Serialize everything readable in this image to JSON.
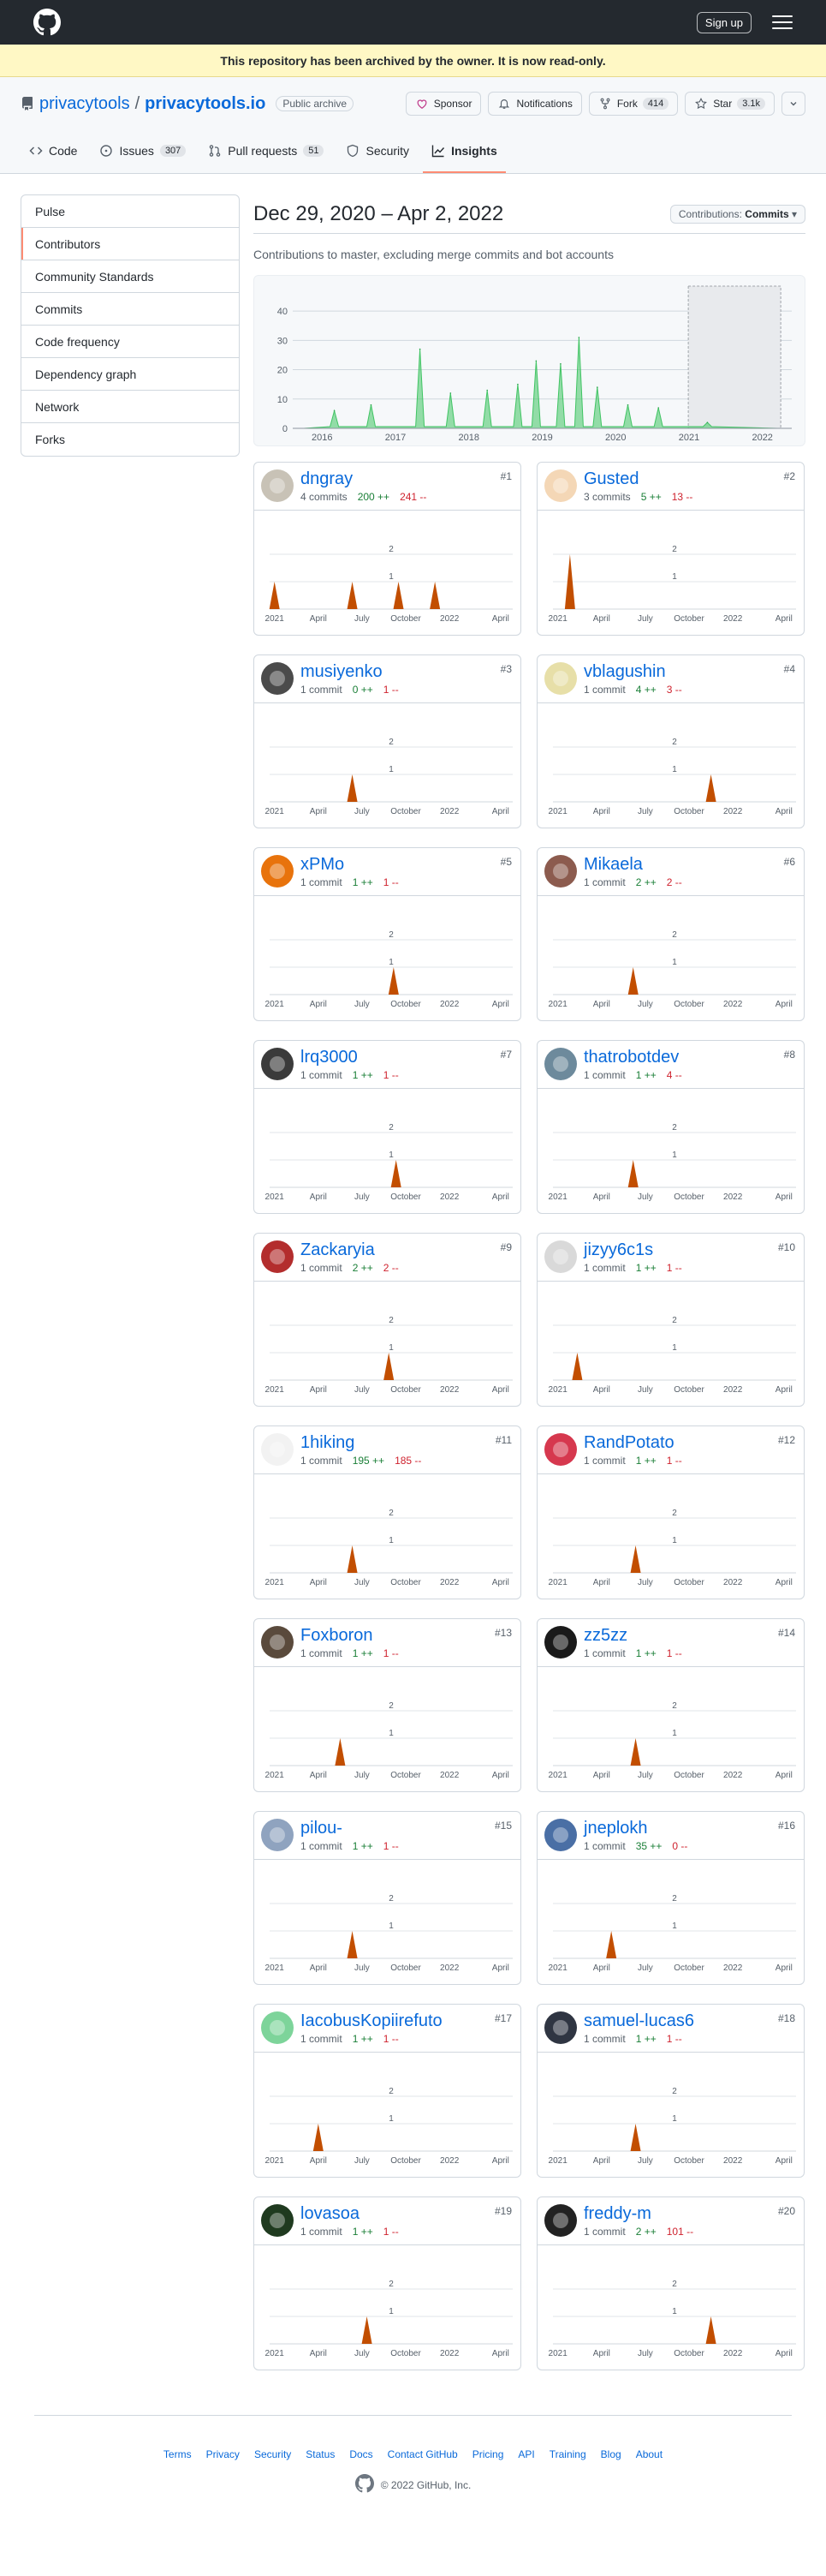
{
  "header": {
    "signup_label": "Sign up",
    "logo_icon": "github-mark-icon",
    "menu_icon": "hamburger-icon"
  },
  "flash": {
    "text": "This repository has been archived by the owner. It is now read-only."
  },
  "repo": {
    "owner": "privacytools",
    "separator": "/",
    "name": "privacytools.io",
    "visibility": "Public archive",
    "actions": {
      "sponsor": "Sponsor",
      "notifications": "Notifications",
      "fork": "Fork",
      "fork_count": "414",
      "star": "Star",
      "star_count": "3.1k"
    }
  },
  "tabs": [
    {
      "label": "Code",
      "icon": "code-icon"
    },
    {
      "label": "Issues",
      "count": "307",
      "icon": "issue-icon"
    },
    {
      "label": "Pull requests",
      "count": "51",
      "icon": "pull-request-icon"
    },
    {
      "label": "Security",
      "icon": "shield-icon"
    },
    {
      "label": "Insights",
      "icon": "graph-icon"
    }
  ],
  "sidenav": [
    "Pulse",
    "Contributors",
    "Community Standards",
    "Commits",
    "Code frequency",
    "Dependency graph",
    "Network",
    "Forks"
  ],
  "content": {
    "range": "Dec 29, 2020 – Apr 2, 2022",
    "selector_prefix": "Contributions:",
    "selector_value": "Commits",
    "subtitle": "Contributions to master, excluding merge commits and bot accounts"
  },
  "chart_data": [
    {
      "type": "area",
      "ylim": [
        0,
        45
      ],
      "y_ticks": [
        "0",
        "10",
        "20",
        "30",
        "40"
      ],
      "x_ticks": [
        "2016",
        "2017",
        "2018",
        "2019",
        "2020",
        "2021",
        "2022"
      ],
      "highlight_range": [
        "Dec 29, 2020",
        "Apr 2, 2022"
      ],
      "peaks": [
        {
          "x": "2016-03",
          "y": 6
        },
        {
          "x": "2016-09",
          "y": 8
        },
        {
          "x": "2017-05",
          "y": 27
        },
        {
          "x": "2017-10",
          "y": 12
        },
        {
          "x": "2018-04",
          "y": 13
        },
        {
          "x": "2018-09",
          "y": 15
        },
        {
          "x": "2018-12",
          "y": 23
        },
        {
          "x": "2019-04",
          "y": 22
        },
        {
          "x": "2019-07",
          "y": 31
        },
        {
          "x": "2019-10",
          "y": 14
        },
        {
          "x": "2020-03",
          "y": 8
        },
        {
          "x": "2020-08",
          "y": 7
        },
        {
          "x": "2021-04",
          "y": 2
        }
      ]
    },
    {
      "type": "contributor-area",
      "x_ticks": [
        "2021",
        "April",
        "July",
        "October",
        "2022",
        "April"
      ],
      "y_ticks": [
        "1",
        "2"
      ],
      "ylim": [
        0,
        2
      ]
    }
  ],
  "contributors": [
    {
      "rank": "#1",
      "name": "dngray",
      "commits": "4 commits",
      "additions": "200 ++",
      "deletions": "241 --",
      "avatar_color": "#c8c2b6",
      "avatar_icon": "seal-avatar-icon",
      "peaks": [
        0.02,
        0.34,
        0.53,
        0.68
      ],
      "heights": [
        1,
        1,
        1,
        1
      ]
    },
    {
      "rank": "#2",
      "name": "Gusted",
      "commits": "3 commits",
      "additions": "5 ++",
      "deletions": "13 --",
      "avatar_color": "#f4d7b6",
      "avatar_icon": "person-avatar-icon",
      "peaks": [
        0.07
      ],
      "heights": [
        2
      ]
    },
    {
      "rank": "#3",
      "name": "musiyenko",
      "commits": "1 commit",
      "additions": "0 ++",
      "deletions": "1 --",
      "avatar_color": "#4b4b4b",
      "avatar_icon": "person-avatar-icon",
      "peaks": [
        0.34
      ],
      "heights": [
        1
      ]
    },
    {
      "rank": "#4",
      "name": "vblagushin",
      "commits": "1 commit",
      "additions": "4 ++",
      "deletions": "3 --",
      "avatar_color": "#e7dfa8",
      "avatar_icon": "identicon-avatar-icon",
      "peaks": [
        0.65
      ],
      "heights": [
        1
      ]
    },
    {
      "rank": "#5",
      "name": "xPMo",
      "commits": "1 commit",
      "additions": "1 ++",
      "deletions": "1 --",
      "avatar_color": "#e8730c",
      "avatar_icon": "symbol-avatar-icon",
      "peaks": [
        0.51
      ],
      "heights": [
        1
      ]
    },
    {
      "rank": "#6",
      "name": "Mikaela",
      "commits": "1 commit",
      "additions": "2 ++",
      "deletions": "2 --",
      "avatar_color": "#8c5b4e",
      "avatar_icon": "person-avatar-icon",
      "peaks": [
        0.33
      ],
      "heights": [
        1
      ]
    },
    {
      "rank": "#7",
      "name": "lrq3000",
      "commits": "1 commit",
      "additions": "1 ++",
      "deletions": "1 --",
      "avatar_color": "#3b3b3b",
      "avatar_icon": "person-avatar-icon",
      "peaks": [
        0.52
      ],
      "heights": [
        1
      ]
    },
    {
      "rank": "#8",
      "name": "thatrobotdev",
      "commits": "1 commit",
      "additions": "1 ++",
      "deletions": "4 --",
      "avatar_color": "#6d8a9c",
      "avatar_icon": "robot-avatar-icon",
      "peaks": [
        0.33
      ],
      "heights": [
        1
      ]
    },
    {
      "rank": "#9",
      "name": "Zackaryia",
      "commits": "1 commit",
      "additions": "2 ++",
      "deletions": "2 --",
      "avatar_color": "#b32d2d",
      "avatar_icon": "symbol-avatar-icon",
      "peaks": [
        0.49
      ],
      "heights": [
        1
      ]
    },
    {
      "rank": "#10",
      "name": "jizyy6c1s",
      "commits": "1 commit",
      "additions": "1 ++",
      "deletions": "1 --",
      "avatar_color": "#d9d9d9",
      "avatar_icon": "sketch-avatar-icon",
      "peaks": [
        0.1
      ],
      "heights": [
        1
      ]
    },
    {
      "rank": "#11",
      "name": "1hiking",
      "commits": "1 commit",
      "additions": "195 ++",
      "deletions": "185 --",
      "avatar_color": "#f2f2f2",
      "avatar_icon": "sketch-avatar-icon",
      "peaks": [
        0.34
      ],
      "heights": [
        1
      ]
    },
    {
      "rank": "#12",
      "name": "RandPotato",
      "commits": "1 commit",
      "additions": "1 ++",
      "deletions": "1 --",
      "avatar_color": "#d6384e",
      "avatar_icon": "identicon-avatar-icon",
      "peaks": [
        0.34
      ],
      "heights": [
        1
      ]
    },
    {
      "rank": "#13",
      "name": "Foxboron",
      "commits": "1 commit",
      "additions": "1 ++",
      "deletions": "1 --",
      "avatar_color": "#5a4a3c",
      "avatar_icon": "person-avatar-icon",
      "peaks": [
        0.29
      ],
      "heights": [
        1
      ]
    },
    {
      "rank": "#14",
      "name": "zz5zz",
      "commits": "1 commit",
      "additions": "1 ++",
      "deletions": "1 --",
      "avatar_color": "#1a1a1a",
      "avatar_icon": "symbol-avatar-icon",
      "peaks": [
        0.34
      ],
      "heights": [
        1
      ]
    },
    {
      "rank": "#15",
      "name": "pilou-",
      "commits": "1 commit",
      "additions": "1 ++",
      "deletions": "1 --",
      "avatar_color": "#8fa3bf",
      "avatar_icon": "sketch-avatar-icon",
      "peaks": [
        0.34
      ],
      "heights": [
        1
      ]
    },
    {
      "rank": "#16",
      "name": "jneplokh",
      "commits": "1 commit",
      "additions": "35 ++",
      "deletions": "0 --",
      "avatar_color": "#4a6fa5",
      "avatar_icon": "person-avatar-icon",
      "peaks": [
        0.24
      ],
      "heights": [
        1
      ]
    },
    {
      "rank": "#17",
      "name": "IacobusKopiirefuto",
      "commits": "1 commit",
      "additions": "1 ++",
      "deletions": "1 --",
      "avatar_color": "#7dd49a",
      "avatar_icon": "identicon-avatar-icon",
      "peaks": [
        0.2
      ],
      "heights": [
        1
      ]
    },
    {
      "rank": "#18",
      "name": "samuel-lucas6",
      "commits": "1 commit",
      "additions": "1 ++",
      "deletions": "1 --",
      "avatar_color": "#2f3542",
      "avatar_icon": "person-avatar-icon",
      "peaks": [
        0.34
      ],
      "heights": [
        1
      ]
    },
    {
      "rank": "#19",
      "name": "lovasoa",
      "commits": "1 commit",
      "additions": "1 ++",
      "deletions": "1 --",
      "avatar_color": "#1f3a1f",
      "avatar_icon": "symbol-avatar-icon",
      "peaks": [
        0.4
      ],
      "heights": [
        1
      ]
    },
    {
      "rank": "#20",
      "name": "freddy-m",
      "commits": "1 commit",
      "additions": "2 ++",
      "deletions": "101 --",
      "avatar_color": "#222222",
      "avatar_icon": "person-avatar-icon",
      "peaks": [
        0.65
      ],
      "heights": [
        1
      ]
    }
  ],
  "footer": {
    "links": [
      "Terms",
      "Privacy",
      "Security",
      "Status",
      "Docs",
      "Contact GitHub",
      "Pricing",
      "API",
      "Training",
      "Blog",
      "About"
    ],
    "copyright": "© 2022 GitHub, Inc."
  }
}
